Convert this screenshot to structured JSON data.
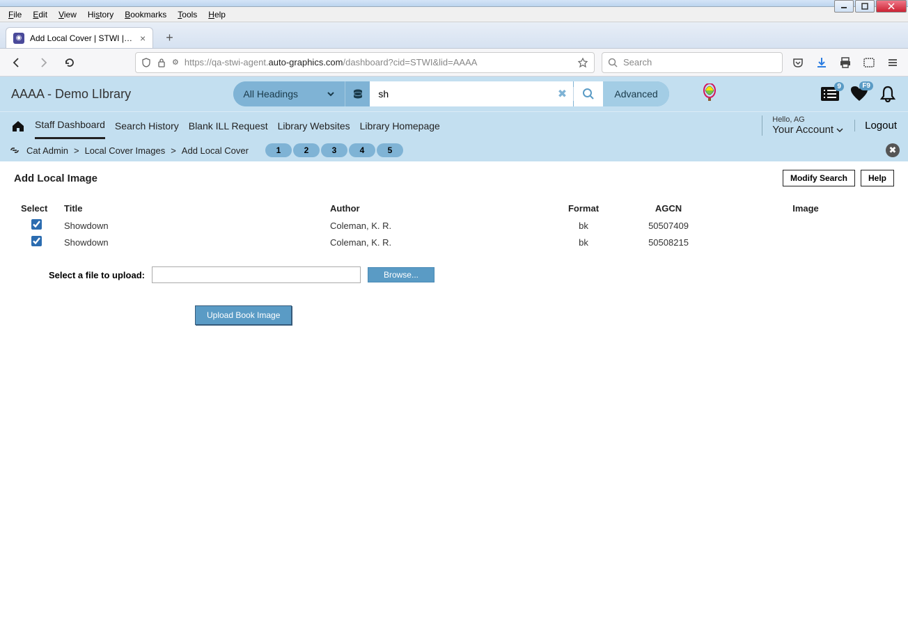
{
  "window": {
    "menus": [
      "File",
      "Edit",
      "View",
      "History",
      "Bookmarks",
      "Tools",
      "Help"
    ]
  },
  "tab": {
    "title": "Add Local Cover | STWI | aaaa |"
  },
  "urlbar": {
    "prefix": "https://qa-stwi-agent.",
    "host": "auto-graphics.com",
    "path": "/dashboard?cid=STWI&lid=AAAA",
    "search_placeholder": "Search"
  },
  "header": {
    "library_name": "AAAA - Demo LIbrary",
    "headings_label": "All Headings",
    "search_value": "sh",
    "advanced_label": "Advanced",
    "list_badge": "9",
    "fav_badge": "F9"
  },
  "nav": {
    "items": [
      "Staff Dashboard",
      "Search History",
      "Blank ILL Request",
      "Library Websites",
      "Library Homepage"
    ],
    "hello": "Hello, AG",
    "account": "Your Account",
    "logout": "Logout"
  },
  "breadcrumb": {
    "items": [
      "Cat Admin",
      "Local Cover Images",
      "Add Local Cover"
    ],
    "steps": [
      "1",
      "2",
      "3",
      "4",
      "5"
    ]
  },
  "page": {
    "title": "Add Local Image",
    "modify_search": "Modify Search",
    "help": "Help",
    "columns": {
      "select": "Select",
      "title": "Title",
      "author": "Author",
      "format": "Format",
      "agcn": "AGCN",
      "image": "Image"
    },
    "rows": [
      {
        "checked": true,
        "title": "Showdown",
        "author": "Coleman, K. R.",
        "format": "bk",
        "agcn": "50507409"
      },
      {
        "checked": true,
        "title": "Showdown",
        "author": "Coleman, K. R.",
        "format": "bk",
        "agcn": "50508215"
      }
    ],
    "upload_label": "Select a file to upload:",
    "browse_label": "Browse...",
    "upload_button": "Upload Book Image"
  }
}
